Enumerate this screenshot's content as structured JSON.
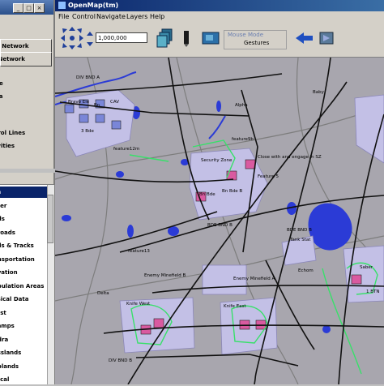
{
  "main_window": {
    "title": "OpenMap(tm)"
  },
  "menu": [
    "File",
    "Control",
    "Navigate",
    "Layers",
    "Help"
  ],
  "toolbar": {
    "scale_value": "1,000,000",
    "mouse_mode_label": "Mouse Mode",
    "mouse_mode_value": "Gestures"
  },
  "left_panel_top": {
    "buttons": [
      "ate Network",
      "te Network"
    ],
    "rows": [
      "ne",
      "ea",
      "trol Lines",
      "ivities"
    ]
  },
  "layers_list": {
    "items": [
      "ch",
      "ater",
      "ads",
      "ilroads",
      "ails & Tracks",
      "ansportation",
      "evation",
      "opulation Areas",
      "ysical Data",
      "rest",
      "vamps",
      "ndra",
      "asslands",
      "oplands",
      "ltical"
    ],
    "selected_index": 0
  },
  "map_labels": [
    "DIV BND A",
    "Bravo Ele",
    "3 Bde",
    "Bn",
    "CAV",
    "Alpha",
    "Baby",
    "feature12m",
    "feature9b",
    "Security Zone",
    "Close with and engage in SZ",
    "Feature 5",
    "Bn Bde",
    "Bn Bde B",
    "BDE BND B",
    "feature13",
    "BDE BND B",
    "Tank Stat",
    "Enemy Minefield B",
    "Enemy Minefield A",
    "Echom",
    "Delta",
    "Knife West",
    "Knife East",
    "Saber",
    "1 BTN",
    "DIV BND B"
  ],
  "colors": {
    "map_bg": "#a8a6ae",
    "water": "#2b3bd6",
    "zone_fill": "#c3c0e6",
    "unit_fill": "#d95aa0",
    "unit_blue": "#7a86d8",
    "line_green": "#38e06a",
    "boundary": "#111111",
    "road": "#7a7a7a"
  }
}
